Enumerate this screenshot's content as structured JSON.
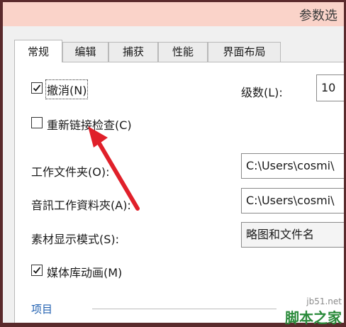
{
  "window": {
    "title": "参数选"
  },
  "tabs": [
    {
      "label": "常规",
      "active": true
    },
    {
      "label": "编辑",
      "active": false
    },
    {
      "label": "捕获",
      "active": false
    },
    {
      "label": "性能",
      "active": false
    },
    {
      "label": "界面布局",
      "active": false
    }
  ],
  "general": {
    "undo": {
      "label": "撤消(N)",
      "checked": true
    },
    "levels": {
      "label": "级数(L):",
      "value": "10"
    },
    "relink": {
      "label": "重新链接检查(C)",
      "checked": false
    },
    "work_folder": {
      "label": "工作文件夹(O):",
      "value": "C:\\Users\\cosmi\\"
    },
    "audio_folder": {
      "label": "音訊工作資料夾(A):",
      "value": "C:\\Users\\cosmi\\"
    },
    "thumb_mode": {
      "label": "素材显示模式(S):",
      "value": "略图和文件名"
    },
    "media_anim": {
      "label": "媒体库动画(M)",
      "checked": true
    },
    "section_project": "项目"
  },
  "annotation": {
    "arrow_color": "#e0202a"
  },
  "watermark": {
    "url": "jb51.net",
    "name": "脚本之家"
  }
}
